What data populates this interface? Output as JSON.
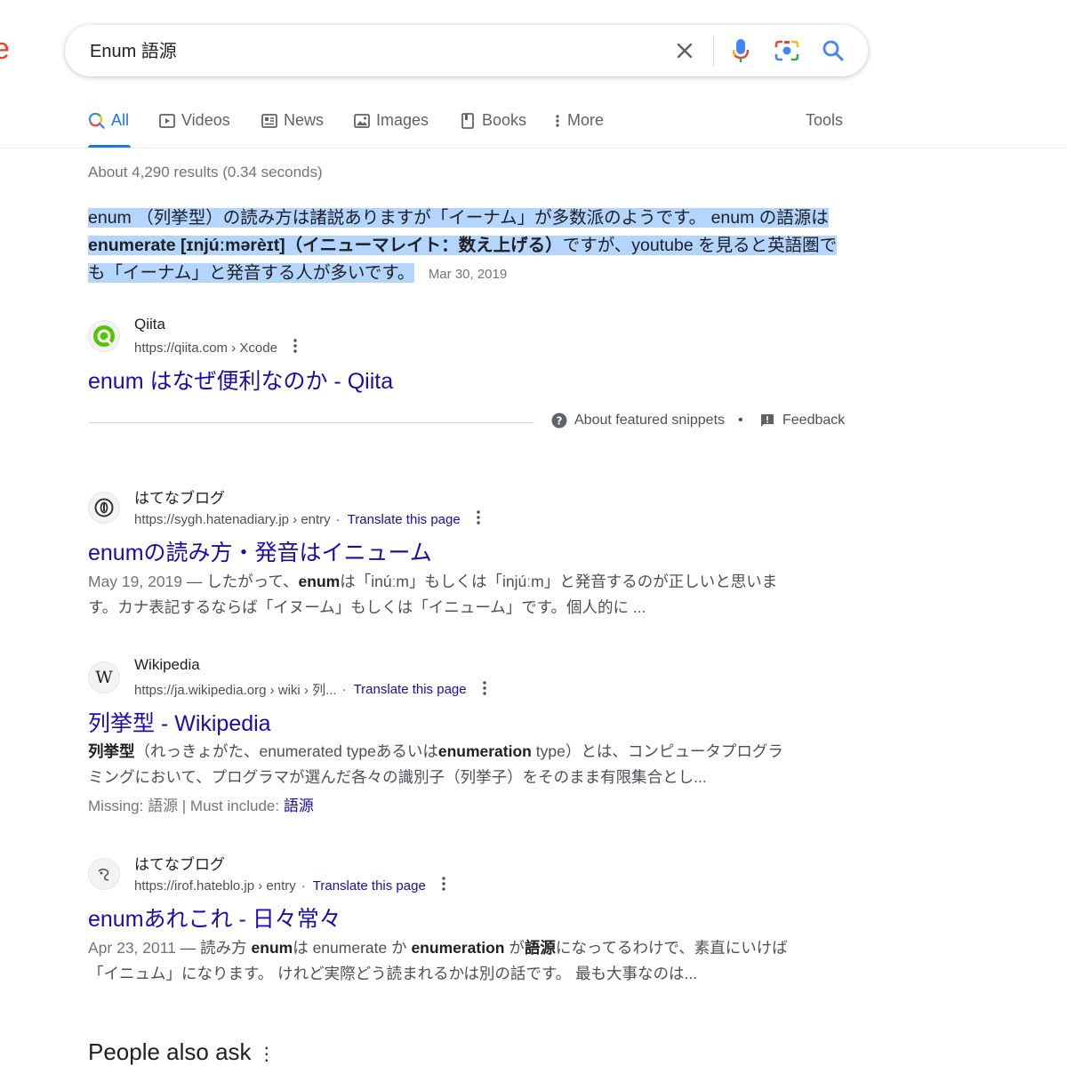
{
  "logo": {
    "fragment": "e"
  },
  "search": {
    "query": "Enum 語源"
  },
  "tabs": [
    {
      "label": "All"
    },
    {
      "label": "Videos"
    },
    {
      "label": "News"
    },
    {
      "label": "Images"
    },
    {
      "label": "Books"
    },
    {
      "label": "More"
    }
  ],
  "tools_label": "Tools",
  "stats": "About 4,290 results (0.34 seconds)",
  "featured_snippet": {
    "text_1": "enum （列挙型）の読み方は諸説ありますが「イーナム」が多数派のようです。 enum の語源は ",
    "bold": "enumerate [ɪnjúːmərèɪt]（イニューマレイト：数え上げる）",
    "text_2": "ですが、youtube を見ると英語圏でも「イーナム」と発音する人が多いです。",
    "date": "Mar 30, 2019",
    "source_name": "Qiita",
    "source_url": "https://qiita.com › Xcode",
    "title": "enum はなぜ便利なのか - Qiita"
  },
  "snippet_footer": {
    "about": "About featured snippets",
    "separator": "•",
    "feedback": "Feedback"
  },
  "results": [
    {
      "site": "はてなブログ",
      "url": "https://sygh.hatenadiary.jp › entry",
      "translate": "Translate this page",
      "title": "enumの読み方・発音はイニューム",
      "date": "May 19, 2019",
      "desc_a": " — したがって、",
      "desc_b1": "enum",
      "desc_c": "は「inúːm」もしくは「injúːm」と発音するのが正しいと思います。カナ表記するならば「イヌーム」もしくは「イニューム」です。個人的に ..."
    },
    {
      "site": "Wikipedia",
      "url": "https://ja.wikipedia.org › wiki › 列...",
      "translate": "Translate this page",
      "title": "列挙型 - Wikipedia",
      "desc_b1": "列挙型",
      "desc_a": "（れっきょがた、enumerated typeあるいは",
      "desc_b2": "enumeration",
      "desc_c": " type）とは、コンピュータプログラミングにおいて、プログラマが選んだ各々の識別子（列挙子）をそのまま有限集合とし...",
      "missing_label": "Missing: 語源 | Must include: ",
      "missing_link": "語源"
    },
    {
      "site": "はてなブログ",
      "url": "https://irof.hateblo.jp › entry",
      "translate": "Translate this page",
      "title": "enumあれこれ - 日々常々",
      "date": "Apr 23, 2011",
      "desc_a": " — 読み方 ",
      "desc_b1": "enum",
      "desc_c": "は enumerate か ",
      "desc_b2": "enumeration",
      "desc_d": " が",
      "desc_b3": "語源",
      "desc_e": "になってるわけで、素直にいけば「イニュム」になります。 けれど実際どう読まれるかは別の話です。 最も大事なのは..."
    }
  ],
  "people_also_ask": "People also ask",
  "colors": {
    "link": "#1a0dab",
    "accent": "#1a73e8",
    "highlight": "#b4d5fe"
  },
  "icons": [
    "clear-icon",
    "mic-icon",
    "lens-icon",
    "search-icon",
    "kebab-icon",
    "help-icon",
    "feedback-icon"
  ]
}
